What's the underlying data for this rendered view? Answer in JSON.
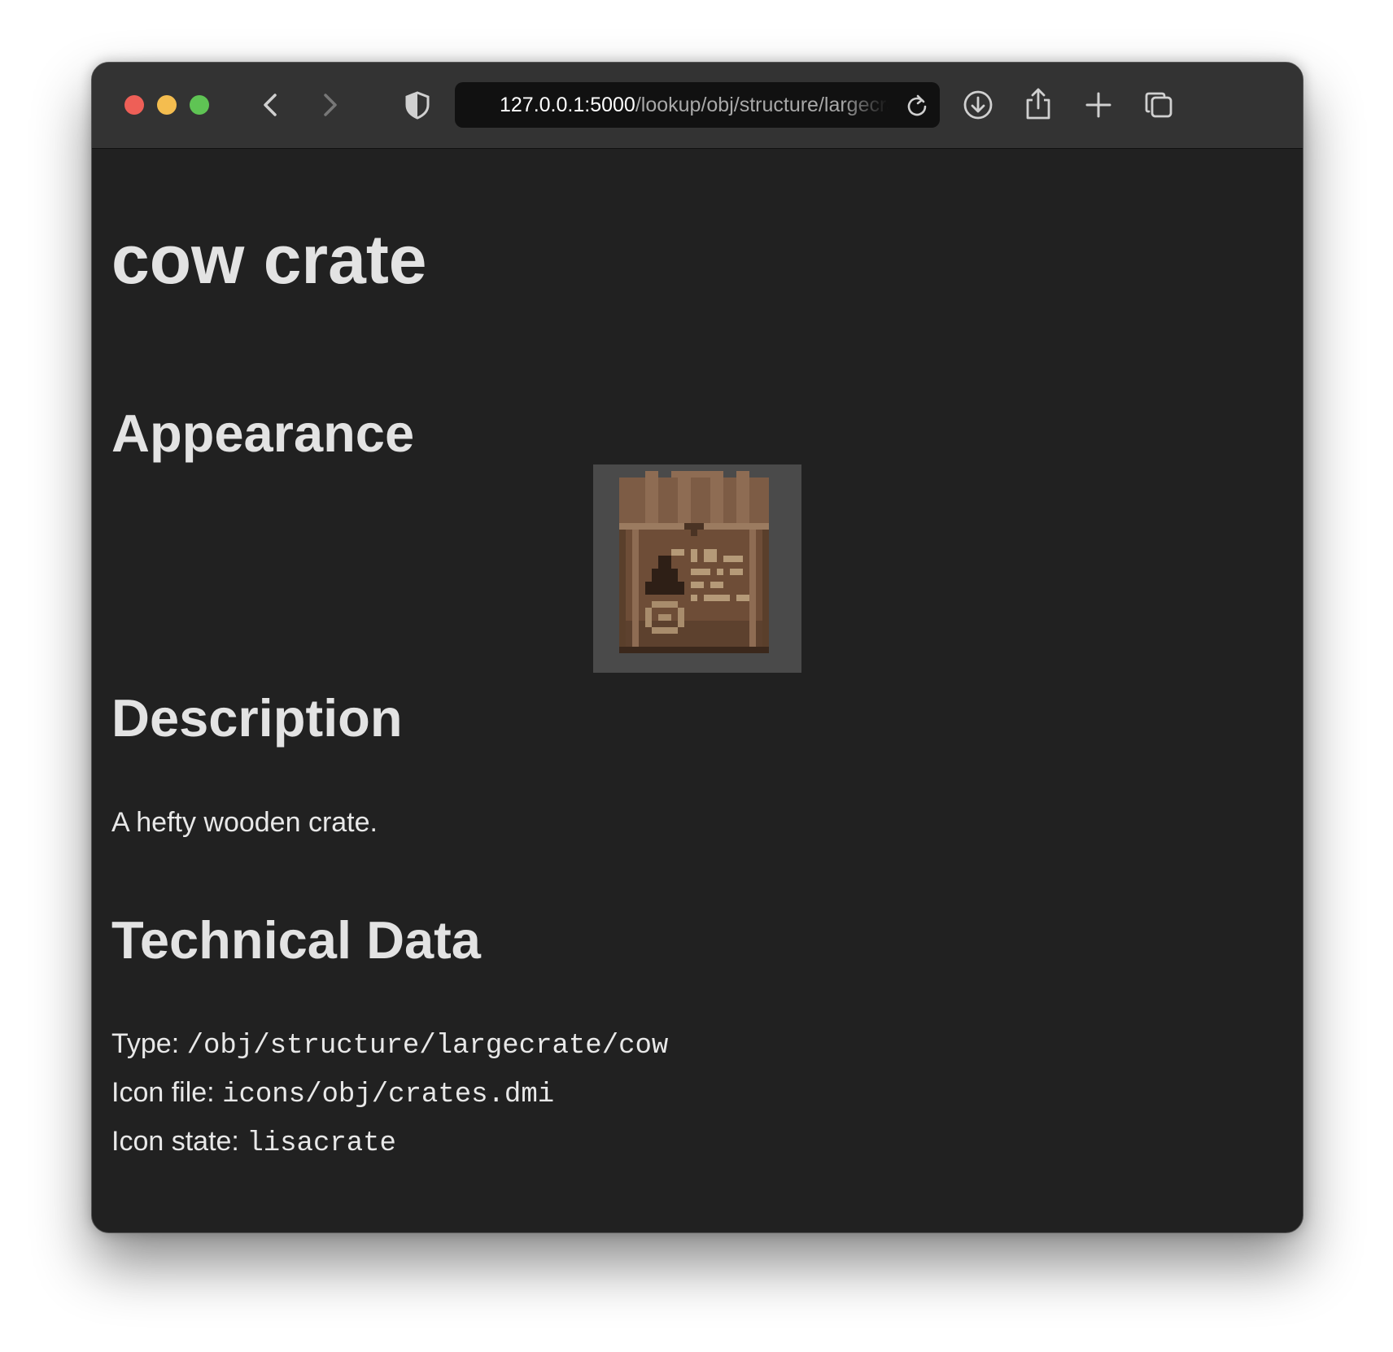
{
  "browser": {
    "address": {
      "host": "127.0.0.1:5000",
      "path": "/lookup/obj/structure/largecrate/cow"
    },
    "icons": {
      "back": "chevron-left-icon",
      "forward": "chevron-right-icon",
      "privacy": "shield-icon",
      "reload": "reload-icon",
      "download": "download-icon",
      "share": "share-icon",
      "new_tab": "plus-icon",
      "tabs": "tab-overview-icon"
    },
    "traffic_colors": {
      "close": "#ee5f57",
      "minimize": "#f4bd4f",
      "maximize": "#5fc454"
    }
  },
  "page": {
    "title": "cow crate",
    "appearance_heading": "Appearance",
    "sprite_icon": "wooden-crate-sprite",
    "description_heading": "Description",
    "description": "A hefty wooden crate.",
    "technical_heading": "Technical Data",
    "technical": {
      "type_label": "Type: ",
      "type_value": "/obj/structure/largecrate/cow",
      "icon_file_label": "Icon file: ",
      "icon_file_value": "icons/obj/crates.dmi",
      "icon_state_label": "Icon state: ",
      "icon_state_value": "lisacrate"
    }
  },
  "colors": {
    "page_background": "#212121",
    "toolbar_background": "#333333",
    "text": "#e3e3e3"
  }
}
